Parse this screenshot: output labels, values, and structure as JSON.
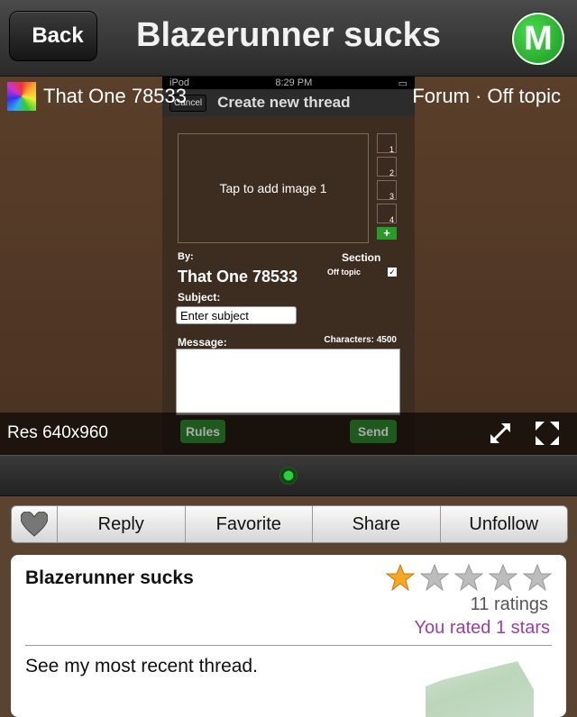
{
  "navbar": {
    "back_label": "Back",
    "title": "Blazerunner sucks",
    "logo_letter": "M"
  },
  "preview": {
    "author": "That One 78533",
    "forum": "Forum · Off topic",
    "resolution": "Res 640x960",
    "phone": {
      "status_left": "iPod",
      "status_time": "8:29 PM",
      "cancel": "Cancel",
      "title": "Create new thread",
      "image_prompt": "Tap to add image 1",
      "thumbs": [
        "1",
        "2",
        "3",
        "4"
      ],
      "add_label": "+",
      "by_label": "By:",
      "by_name": "That One 78533",
      "section_label": "Section",
      "section_value": "Off topic",
      "subject_label": "Subject:",
      "subject_placeholder": "Enter subject",
      "message_label": "Message:",
      "characters": "Characters: 4500",
      "rules": "Rules",
      "send": "Send"
    }
  },
  "actions": {
    "reply": "Reply",
    "favorite": "Favorite",
    "share": "Share",
    "unfollow": "Unfollow"
  },
  "card": {
    "title": "Blazerunner sucks",
    "rating_count": "11 ratings",
    "user_rating": "You rated 1 stars",
    "stars_filled": 1,
    "stars_total": 5,
    "body": "See my most recent thread."
  },
  "colors": {
    "accent_green": "#2a9a2a",
    "rating_purple": "#9b3fa8",
    "star_gold": "#f5a623"
  }
}
